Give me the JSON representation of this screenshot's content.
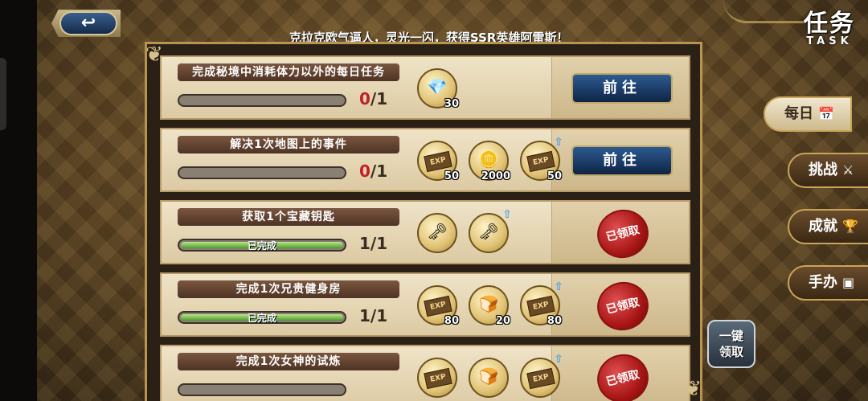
{
  "header": {
    "back_icon": "↩",
    "title_cn": "任务",
    "title_en": "TASK",
    "marquee": "克拉克欧气逼人，灵光一闪，获得SSR英雄阿雷斯！"
  },
  "tasks": [
    {
      "name": "完成秘境中消耗体力以外的每日任务",
      "progress_current": "0",
      "progress_sep": "/1",
      "progress_fraction": 0,
      "bar_text": "",
      "rewards": [
        {
          "icon": "rainbow-crystal-icon",
          "glyph": "💎",
          "qty": "30",
          "boost": false
        }
      ],
      "action": {
        "type": "go",
        "label": "前往"
      }
    },
    {
      "name": "解决1次地图上的事件",
      "progress_current": "0",
      "progress_sep": "/1",
      "progress_fraction": 0,
      "bar_text": "",
      "rewards": [
        {
          "icon": "exp-ticket-icon",
          "glyph": "EXP",
          "qty": "50",
          "boost": false
        },
        {
          "icon": "gold-coin-icon",
          "glyph": "🪙",
          "qty": "2000",
          "boost": false
        },
        {
          "icon": "exp-ticket-icon",
          "glyph": "EXP",
          "qty": "50",
          "boost": true
        }
      ],
      "action": {
        "type": "go",
        "label": "前往"
      }
    },
    {
      "name": "获取1个宝藏钥匙",
      "progress_current": "1",
      "progress_sep": "/1",
      "progress_fraction": 1,
      "bar_text": "已完成",
      "rewards": [
        {
          "icon": "treasure-key-icon",
          "glyph": "🗝",
          "qty": "",
          "boost": false
        },
        {
          "icon": "treasure-key-icon",
          "glyph": "🗝",
          "qty": "",
          "boost": true
        }
      ],
      "action": {
        "type": "claimed",
        "label": "已领取"
      }
    },
    {
      "name": "完成1次兄贵健身房",
      "progress_current": "1",
      "progress_sep": "/1",
      "progress_fraction": 1,
      "bar_text": "已完成",
      "rewards": [
        {
          "icon": "exp-ticket-icon",
          "glyph": "EXP",
          "qty": "80",
          "boost": false
        },
        {
          "icon": "bread-icon",
          "glyph": "🍞",
          "qty": "20",
          "boost": false
        },
        {
          "icon": "exp-ticket-icon",
          "glyph": "EXP",
          "qty": "80",
          "boost": true
        }
      ],
      "action": {
        "type": "claimed",
        "label": "已领取"
      }
    },
    {
      "name": "完成1次女神的试炼",
      "progress_current": "",
      "progress_sep": "",
      "progress_fraction": 0,
      "bar_text": "",
      "rewards": [
        {
          "icon": "exp-ticket-icon",
          "glyph": "EXP",
          "qty": "",
          "boost": false
        },
        {
          "icon": "bread-icon",
          "glyph": "🍞",
          "qty": "",
          "boost": false
        },
        {
          "icon": "exp-ticket-icon",
          "glyph": "EXP",
          "qty": "",
          "boost": true
        }
      ],
      "action": {
        "type": "claimed",
        "label": "已领取"
      }
    }
  ],
  "side_tabs": [
    {
      "label": "每日",
      "icon": "calendar-icon",
      "glyph": "📅",
      "active": true
    },
    {
      "label": "挑战",
      "icon": "crossed-swords-icon",
      "glyph": "⚔",
      "active": false
    },
    {
      "label": "成就",
      "icon": "trophy-icon",
      "glyph": "🏆",
      "active": false
    },
    {
      "label": "手办",
      "icon": "figure-icon",
      "glyph": "▣",
      "active": false
    }
  ],
  "claim_all": {
    "line1": "一键",
    "line2": "领取"
  }
}
